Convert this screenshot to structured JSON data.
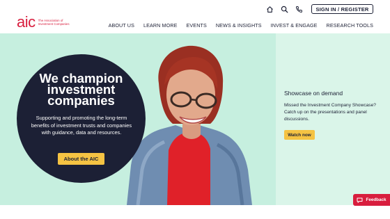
{
  "logo": {
    "mark": "aic",
    "subtitle": "The Association of Investment Companies"
  },
  "utility": {
    "home_icon": "home-icon",
    "search_icon": "search-icon",
    "phone_icon": "phone-icon",
    "signin_label": "SIGN IN / REGISTER"
  },
  "nav": {
    "items": [
      {
        "label": "ABOUT US"
      },
      {
        "label": "LEARN MORE"
      },
      {
        "label": "EVENTS"
      },
      {
        "label": "NEWS & INSIGHTS"
      },
      {
        "label": "INVEST & ENGAGE"
      },
      {
        "label": "RESEARCH TOOLS"
      }
    ]
  },
  "hero": {
    "headline": "We champion investment companies",
    "body": "Supporting and promoting the long-term benefits of investment trusts and companies with guidance, data and resources.",
    "cta_label": "About the AIC"
  },
  "showcase": {
    "title": "Showcase on demand",
    "body": "Missed the Investment Company Showcase? Catch up on the presentations and panel discussions.",
    "cta_label": "Watch now"
  },
  "feedback": {
    "label": "Feedback",
    "icon": "chat-icon"
  },
  "colors": {
    "brand_red": "#d81e3e",
    "navy": "#1c2035",
    "mint": "#c6efdf",
    "accent_yellow": "#f5c343"
  }
}
